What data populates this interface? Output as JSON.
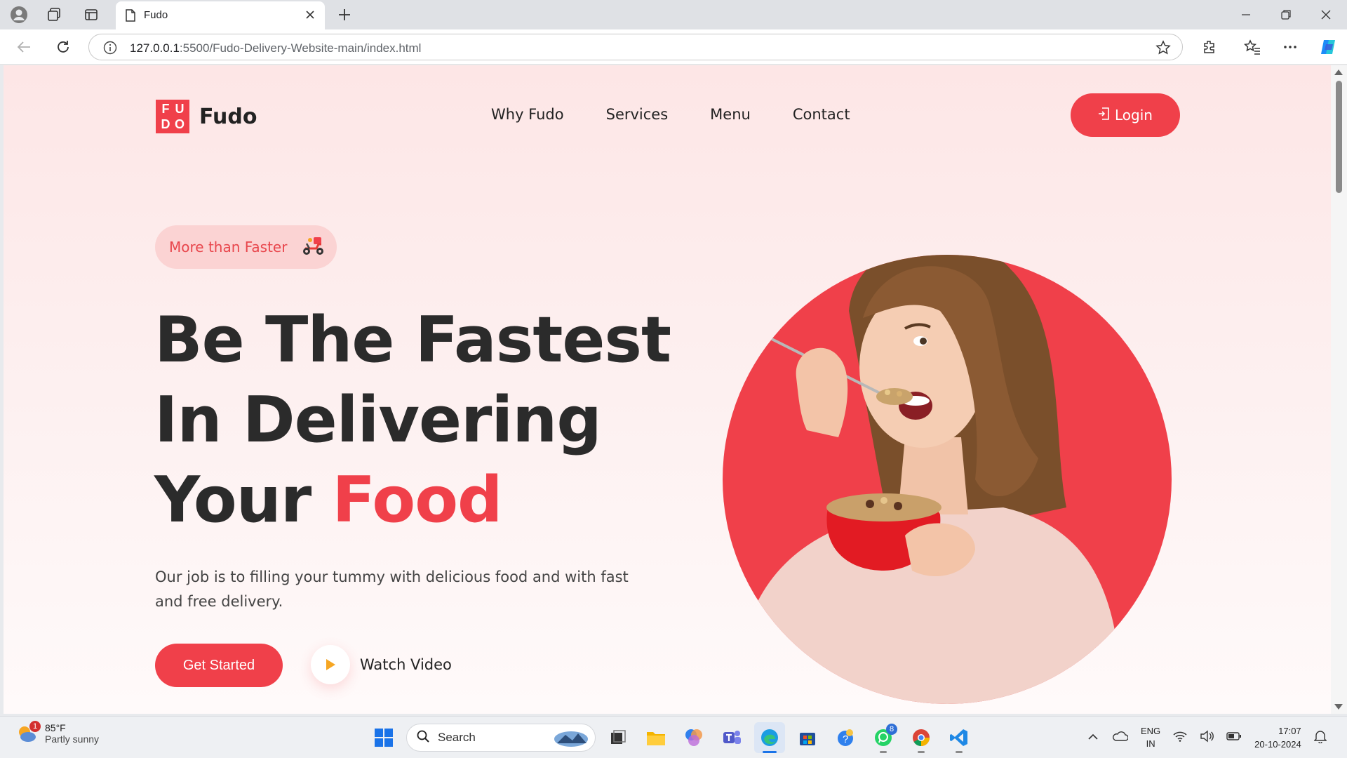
{
  "browser": {
    "tab_title": "Fudo",
    "url_host": "127.0.0.1",
    "url_rest": ":5500/Fudo-Delivery-Website-main/index.html"
  },
  "site": {
    "brand": "Fudo",
    "logo_letters": [
      "F",
      "U",
      "D",
      "O"
    ],
    "nav": [
      "Why Fudo",
      "Services",
      "Menu",
      "Contact"
    ],
    "login_label": "Login",
    "tagline_pill": "More than Faster",
    "headline_line1": "Be The Fastest",
    "headline_line2": "In Delivering",
    "headline_line3_prefix": "Your",
    "headline_line3_accent": "Food",
    "description": "Our job is to filling your tummy with delicious food and with fast and free delivery.",
    "cta_label": "Get Started",
    "watch_label": "Watch Video",
    "accent_color": "#f0404a"
  },
  "taskbar": {
    "weather_temp": "85°F",
    "weather_desc": "Partly sunny",
    "weather_badge": "1",
    "search_label": "Search",
    "whatsapp_badge": "8",
    "lang_line1": "ENG",
    "lang_line2": "IN",
    "time": "17:07",
    "date": "20-10-2024"
  }
}
